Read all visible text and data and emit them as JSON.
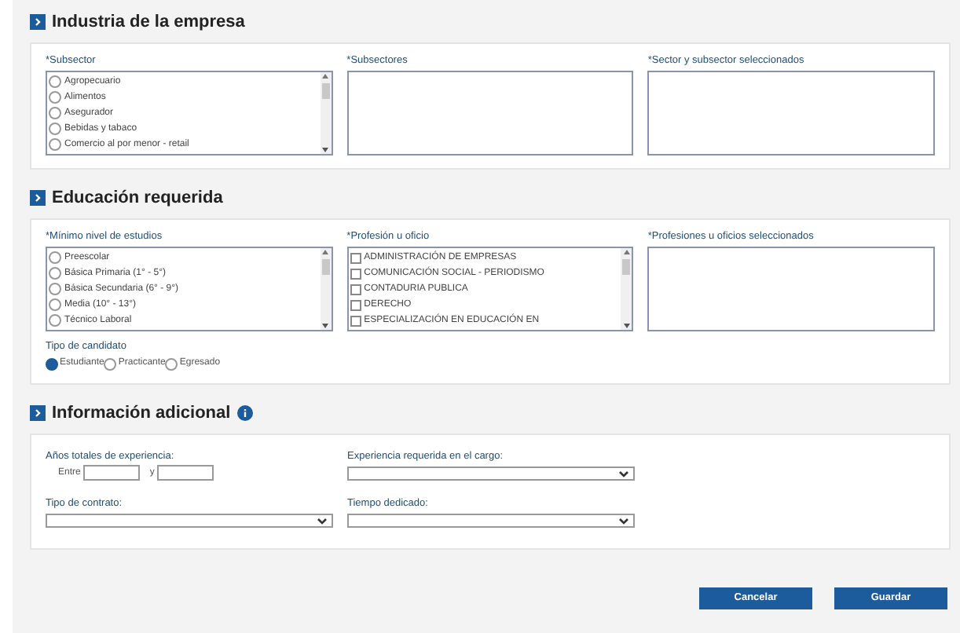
{
  "sections": [
    {
      "title": "Industria de la empresa",
      "kind": "lists",
      "boxes": [
        {
          "label": "*Subsector",
          "kind": "radio",
          "items": [
            {
              "text": "Agropecuario",
              "checked": false
            },
            {
              "text": "Alimentos",
              "checked": false
            },
            {
              "text": "Asegurador",
              "checked": false
            },
            {
              "text": "Bebidas y tabaco",
              "checked": false
            },
            {
              "text": "Comercio al por menor - retail",
              "checked": false
            }
          ]
        },
        {
          "label": "*Subsectores",
          "kind": "empty"
        },
        {
          "label": "*Sector y subsector seleccionados",
          "kind": "empty"
        }
      ]
    },
    {
      "title": "Educación requerida",
      "kind": "lists",
      "boxes": [
        {
          "label": "*Mínimo nivel de estudios",
          "kind": "radio",
          "items": [
            {
              "text": "Preescolar",
              "checked": false
            },
            {
              "text": "Básica Primaria (1° - 5°)",
              "checked": false
            },
            {
              "text": "Básica Secundaria (6° - 9°)",
              "checked": false
            },
            {
              "text": "Media (10° - 13°)",
              "checked": false
            },
            {
              "text": "Técnico Laboral",
              "checked": false
            }
          ]
        },
        {
          "label": "*Profesión u oficio",
          "kind": "checkbox",
          "items": [
            {
              "text": "ADMINISTRACIÓN DE EMPRESAS",
              "checked": false
            },
            {
              "text": "COMUNICACIÓN SOCIAL - PERIODISMO",
              "checked": false
            },
            {
              "text": "CONTADURIA PUBLICA",
              "checked": false
            },
            {
              "text": "DERECHO",
              "checked": false
            },
            {
              "text": "ESPECIALIZACIÓN EN EDUCACIÓN EN",
              "checked": false
            }
          ]
        },
        {
          "label": "*Profesiones u oficios seleccionados",
          "kind": "empty"
        }
      ],
      "candidate": {
        "label": "Tipo de candidato",
        "options": [
          {
            "text": "Estudiante",
            "selected": true
          },
          {
            "text": "Practicante",
            "selected": false
          },
          {
            "text": "Egresado",
            "selected": false
          }
        ]
      }
    },
    {
      "title": "Información adicional",
      "kind": "fields",
      "info": true,
      "range": {
        "label": "Años totales de experiencia:",
        "from": "Entre",
        "to": "y"
      },
      "selects": [
        {
          "label": "Experiencia requerida en el cargo:"
        },
        {
          "label": "Tipo de contrato:"
        },
        {
          "label": "Tiempo dedicado:"
        }
      ]
    }
  ],
  "buttons": [
    {
      "label": "Cancelar"
    },
    {
      "label": "Guardar"
    }
  ]
}
